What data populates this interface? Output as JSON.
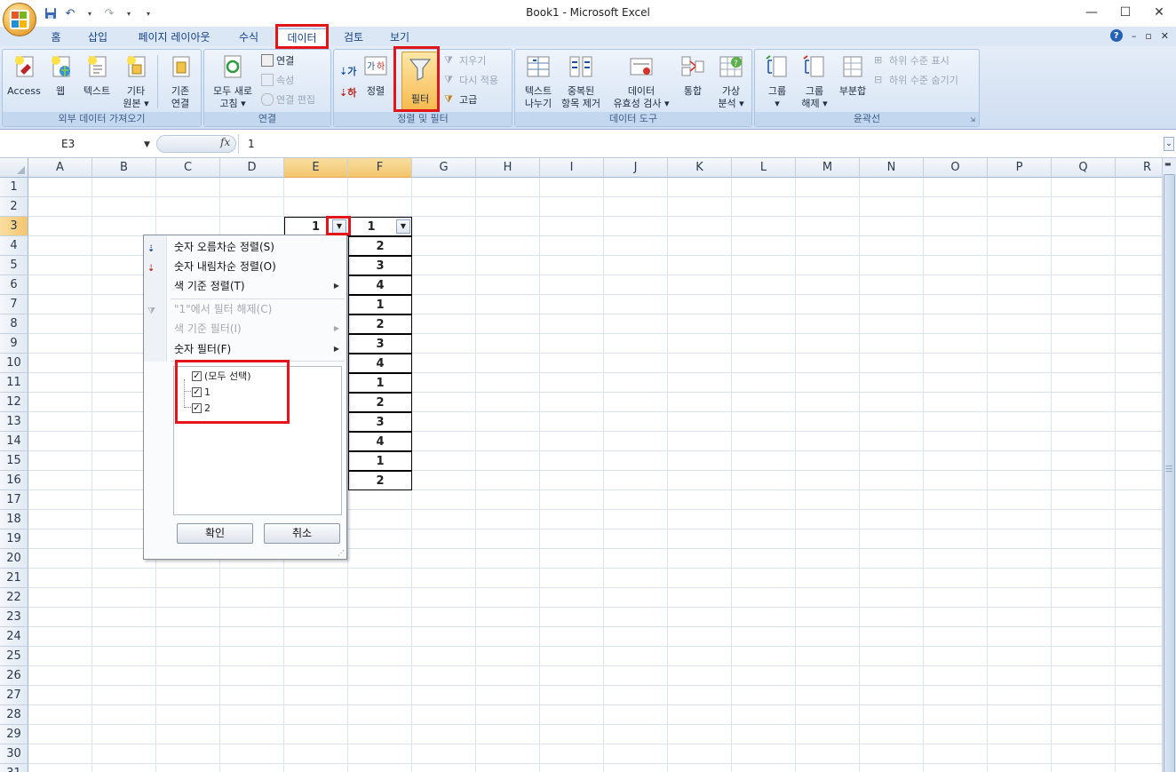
{
  "window": {
    "title": "Book1 - Microsoft Excel",
    "minimize": "—",
    "maximize": "☐",
    "close": "✕"
  },
  "tabs": [
    "홈",
    "삽입",
    "페이지 레이아웃",
    "수식",
    "데이터",
    "검토",
    "보기"
  ],
  "active_tab": "데이터",
  "ribbon": {
    "external": {
      "label": "외부 데이터 가져오기",
      "access": "Access",
      "web": "웹",
      "text": "텍스트",
      "other_line1": "기타",
      "other_line2": "원본 ▾",
      "existing_line1": "기존",
      "existing_line2": "연결"
    },
    "connections": {
      "label": "연결",
      "refresh_line1": "모두 새로",
      "refresh_line2": "고침 ▾",
      "connections": "연결",
      "properties": "속성",
      "edit_links": "연결 편집"
    },
    "sort_filter": {
      "label": "정렬 및 필터",
      "sort": "정렬",
      "filter": "필터",
      "clear": "지우기",
      "reapply": "다시 적용",
      "advanced": "고급",
      "az": "가",
      "za": "하"
    },
    "data_tools": {
      "label": "데이터 도구",
      "text_to_cols_line1": "텍스트",
      "text_to_cols_line2": "나누기",
      "remove_dup_line1": "중복된",
      "remove_dup_line2": "항목 제거",
      "validation_line1": "데이터",
      "validation_line2": "유효성 검사 ▾",
      "consolidate": "통합",
      "whatif_line1": "가상",
      "whatif_line2": "분석 ▾"
    },
    "outline": {
      "label": "윤곽선",
      "group_line1": "그룹",
      "group_line2": "▾",
      "ungroup_line1": "그룹",
      "ungroup_line2": "해제 ▾",
      "subtotal": "부분합",
      "show_detail": "하위 수준 표시",
      "hide_detail": "하위 수준 숨기기"
    }
  },
  "formula_bar": {
    "name_box": "E3",
    "fx": "fx",
    "value": "1"
  },
  "columns": [
    "A",
    "B",
    "C",
    "D",
    "E",
    "F",
    "G",
    "H",
    "I",
    "J",
    "K",
    "L",
    "M",
    "N",
    "O",
    "P",
    "Q",
    "R"
  ],
  "rows": [
    "1",
    "2",
    "3",
    "4",
    "5",
    "6",
    "7",
    "8",
    "9",
    "10",
    "11",
    "12",
    "13",
    "14",
    "15",
    "16",
    "17",
    "18",
    "19",
    "20",
    "21",
    "22",
    "23",
    "24",
    "25",
    "26",
    "27",
    "28",
    "29",
    "30",
    "31"
  ],
  "cells": {
    "E3": "1",
    "F": [
      "1",
      "2",
      "3",
      "4",
      "1",
      "2",
      "3",
      "4",
      "1",
      "2",
      "3",
      "4",
      "1",
      "2"
    ]
  },
  "filter_menu": {
    "sort_asc": "숫자 오름차순 정렬(S)",
    "sort_desc": "숫자 내림차순 정렬(O)",
    "sort_by_color": "색 기준 정렬(T)",
    "clear_filter": "\"1\"에서 필터 해제(C)",
    "filter_by_color": "색 기준 필터(I)",
    "number_filters": "숫자 필터(F)",
    "select_all": "(모두 선택)",
    "values": [
      "1",
      "2"
    ],
    "ok": "확인",
    "cancel": "취소"
  },
  "colors": {
    "highlight": "#e3151a",
    "selected_header": "#f3c56e",
    "ribbon_bg": "#cfdef2"
  }
}
